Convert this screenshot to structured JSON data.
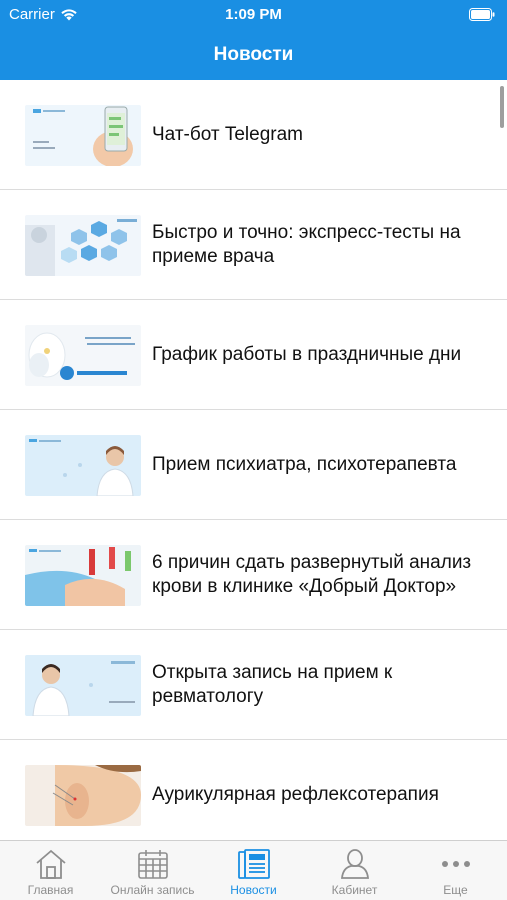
{
  "status_bar": {
    "carrier": "Carrier",
    "time": "1:09 PM"
  },
  "header": {
    "title": "Новости"
  },
  "news": {
    "items": [
      {
        "title": "Чат-бот Telegram",
        "thumb_icon": "telegram-phone-image"
      },
      {
        "title": "Быстро и точно: экспресс-тесты на приеме врача",
        "thumb_icon": "medical-icons-image"
      },
      {
        "title": "График работы в праздничные дни",
        "thumb_icon": "holiday-schedule-image"
      },
      {
        "title": "Прием психиатра, психотерапевта",
        "thumb_icon": "doctor-portrait-image"
      },
      {
        "title": "6 причин сдать развернутый анализ крови в клинике «Добрый Доктор»",
        "thumb_icon": "blood-test-image"
      },
      {
        "title": "Открыта запись на прием к ревматологу",
        "thumb_icon": "doctor-portrait-image"
      },
      {
        "title": "Аурикулярная рефлексотерапия",
        "thumb_icon": "ear-acupuncture-image"
      }
    ]
  },
  "tab_bar": {
    "tabs": [
      {
        "label": "Главная",
        "icon": "home-icon",
        "active": false
      },
      {
        "label": "Онлайн запись",
        "icon": "calendar-icon",
        "active": false
      },
      {
        "label": "Новости",
        "icon": "newspaper-icon",
        "active": true
      },
      {
        "label": "Кабинет",
        "icon": "person-icon",
        "active": false
      },
      {
        "label": "Еще",
        "icon": "more-icon",
        "active": false
      }
    ]
  },
  "colors": {
    "brand_blue": "#1a8fe3",
    "tab_inactive": "#8e8e8e",
    "divider": "#dcdcdc"
  }
}
